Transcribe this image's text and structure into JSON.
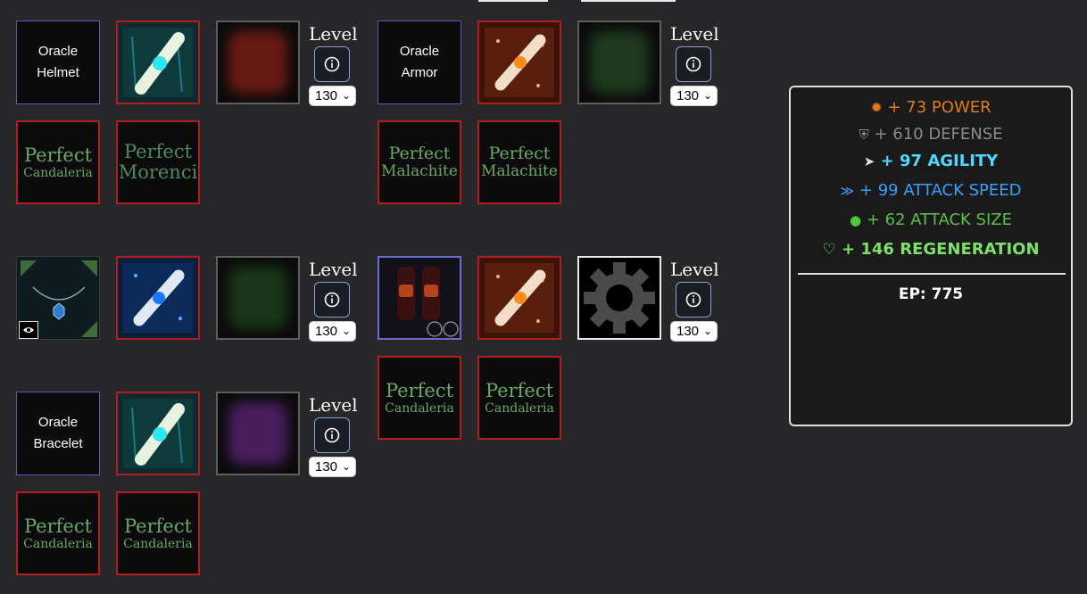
{
  "level_label": "Level",
  "level_select_value": "130",
  "groups": [
    {
      "id": "helmet",
      "item_name": "Oracle\nHelmet",
      "item_line1": "Oracle",
      "item_line2": "Helmet",
      "gems": [
        {
          "line1": "Perfect",
          "line2": "Candaleria"
        },
        {
          "line1": "Perfect",
          "line2": "Morenci"
        }
      ]
    },
    {
      "id": "armor",
      "item_line1": "Oracle",
      "item_line2": "Armor",
      "gems": [
        {
          "line1": "Perfect",
          "line2": "Malachite"
        },
        {
          "line1": "Perfect",
          "line2": "Malachite"
        }
      ]
    },
    {
      "id": "necklace",
      "gems": []
    },
    {
      "id": "boots",
      "gems": [
        {
          "line1": "Perfect",
          "line2": "Candaleria"
        },
        {
          "line1": "Perfect",
          "line2": "Candaleria"
        }
      ]
    },
    {
      "id": "bracelet",
      "item_line1": "Oracle",
      "item_line2": "Bracelet",
      "gems": [
        {
          "line1": "Perfect",
          "line2": "Candaleria"
        },
        {
          "line1": "Perfect",
          "line2": "Candaleria"
        }
      ]
    }
  ],
  "stats": {
    "power": {
      "text": "+ 73 POWER",
      "color": "#e07a20",
      "icon": "star-burst-icon"
    },
    "defense": {
      "text": "+ 610 DEFENSE",
      "color": "#888888",
      "icon": "shield-icon"
    },
    "agility": {
      "text": "+ 97 AGILITY",
      "color": "#4fd8ff",
      "icon": "runner-icon"
    },
    "attack_speed": {
      "text": "+ 99 ATTACK SPEED",
      "color": "#3aa0ff",
      "icon": "speed-icon"
    },
    "attack_size": {
      "text": "+ 62 ATTACK SIZE",
      "color": "#5cbf4a",
      "icon": "planet-icon"
    },
    "regeneration": {
      "text": "+ 146 REGENERATION",
      "color": "#7ee06b",
      "icon": "heart-plus-icon"
    },
    "ep": "EP: 775"
  }
}
